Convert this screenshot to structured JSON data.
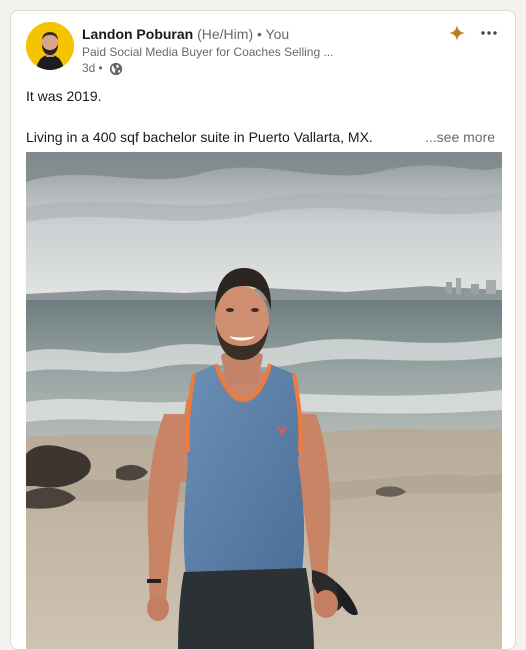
{
  "post": {
    "author": {
      "name": "Landon Poburan",
      "pronouns": "(He/Him)",
      "separator": "•",
      "relation": "You",
      "headline": "Paid Social Media Buyer for Coaches Selling ...",
      "time": "3d",
      "time_separator": "•",
      "visibility_icon": "globe-icon"
    },
    "actions": {
      "ai_icon": "sparkle-icon",
      "menu_icon": "more-horizontal-icon"
    },
    "text": {
      "line1": "It was 2019.",
      "line2": "Living in a 400 sqf bachelor suite in Puerto Vallarta, MX.",
      "see_more": "...see more"
    },
    "colors": {
      "avatar_bg": "#f5c400",
      "sparkle": "#c37d16",
      "tank_top": "#5a7fa8",
      "tank_trim": "#f07a3a"
    }
  }
}
